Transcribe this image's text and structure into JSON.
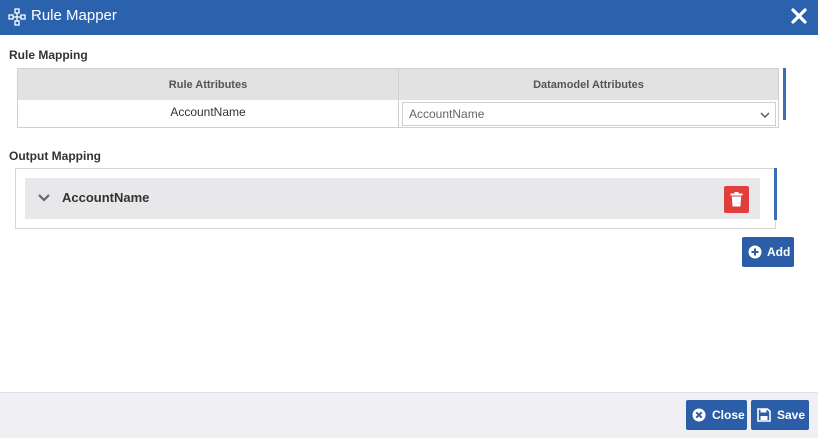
{
  "dialog": {
    "title": "Rule Mapper",
    "title_icon": "flow-nodes-icon",
    "close_icon": "close-icon"
  },
  "rule_mapping": {
    "label": "Rule Mapping",
    "columns": [
      "Rule Attributes",
      "Datamodel Attributes"
    ],
    "rows": [
      {
        "rule_attribute": "AccountName",
        "datamodel_attribute": "AccountName"
      }
    ]
  },
  "output_mapping": {
    "label": "Output Mapping",
    "items": [
      {
        "name": "AccountName"
      }
    ],
    "add_label": "Add"
  },
  "footer": {
    "close_label": "Close",
    "save_label": "Save"
  },
  "colors": {
    "header_bg": "#2b62ad",
    "button_bg": "#2b5ea7",
    "delete_bg": "#e03d3d",
    "footer_bg": "#efeff4"
  }
}
